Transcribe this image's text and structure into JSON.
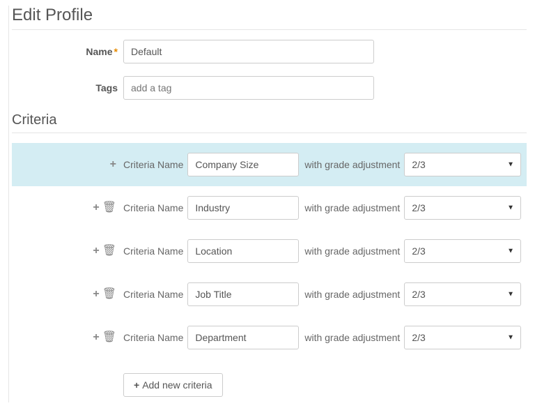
{
  "header": {
    "title": "Edit Profile"
  },
  "form": {
    "name_label": "Name",
    "name_value": "Default",
    "tags_label": "Tags",
    "tags_placeholder": "add a tag"
  },
  "criteria_section": {
    "title": "Criteria",
    "row_label": "Criteria Name",
    "adjustment_label": "with grade adjustment",
    "add_button": "Add new criteria",
    "items": [
      {
        "name": "Company Size",
        "grade": "2/3",
        "highlight": true,
        "show_trash": false
      },
      {
        "name": "Industry",
        "grade": "2/3",
        "highlight": false,
        "show_trash": true
      },
      {
        "name": "Location",
        "grade": "2/3",
        "highlight": false,
        "show_trash": true
      },
      {
        "name": "Job Title",
        "grade": "2/3",
        "highlight": false,
        "show_trash": true
      },
      {
        "name": "Department",
        "grade": "2/3",
        "highlight": false,
        "show_trash": true
      }
    ]
  },
  "icons": {
    "plus": "+",
    "trash": "🗑"
  }
}
